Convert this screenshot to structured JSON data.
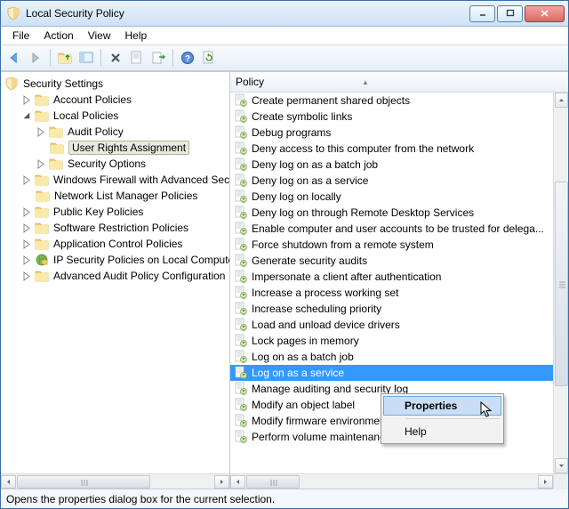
{
  "titlebar": {
    "title": "Local Security Policy"
  },
  "menubar": [
    "File",
    "Action",
    "View",
    "Help"
  ],
  "tree": {
    "root_label": "Security Settings",
    "items": [
      {
        "label": "Account Policies",
        "depth": 1,
        "expander": "closed"
      },
      {
        "label": "Local Policies",
        "depth": 1,
        "expander": "open"
      },
      {
        "label": "Audit Policy",
        "depth": 2,
        "expander": "closed"
      },
      {
        "label": "User Rights Assignment",
        "depth": 2,
        "expander": "none",
        "selected": true
      },
      {
        "label": "Security Options",
        "depth": 2,
        "expander": "closed"
      },
      {
        "label": "Windows Firewall with Advanced Security",
        "depth": 1,
        "expander": "closed"
      },
      {
        "label": "Network List Manager Policies",
        "depth": 1,
        "expander": "none"
      },
      {
        "label": "Public Key Policies",
        "depth": 1,
        "expander": "closed"
      },
      {
        "label": "Software Restriction Policies",
        "depth": 1,
        "expander": "closed"
      },
      {
        "label": "Application Control Policies",
        "depth": 1,
        "expander": "closed"
      },
      {
        "label": "IP Security Policies on Local Computer",
        "depth": 1,
        "expander": "closed",
        "special_icon": "ipsec"
      },
      {
        "label": "Advanced Audit Policy Configuration",
        "depth": 1,
        "expander": "closed"
      }
    ]
  },
  "list": {
    "header": "Policy",
    "rows": [
      "Create permanent shared objects",
      "Create symbolic links",
      "Debug programs",
      "Deny access to this computer from the network",
      "Deny log on as a batch job",
      "Deny log on as a service",
      "Deny log on locally",
      "Deny log on through Remote Desktop Services",
      "Enable computer and user accounts to be trusted for delega...",
      "Force shutdown from a remote system",
      "Generate security audits",
      "Impersonate a client after authentication",
      "Increase a process working set",
      "Increase scheduling priority",
      "Load and unload device drivers",
      "Lock pages in memory",
      "Log on as a batch job",
      "Log on as a service",
      "Manage auditing and security log",
      "Modify an object label",
      "Modify firmware environment values",
      "Perform volume maintenance tasks"
    ],
    "selected_index": 17
  },
  "context_menu": {
    "items": [
      "Properties",
      "Help"
    ]
  },
  "statusbar": "Opens the properties dialog box for the current selection."
}
